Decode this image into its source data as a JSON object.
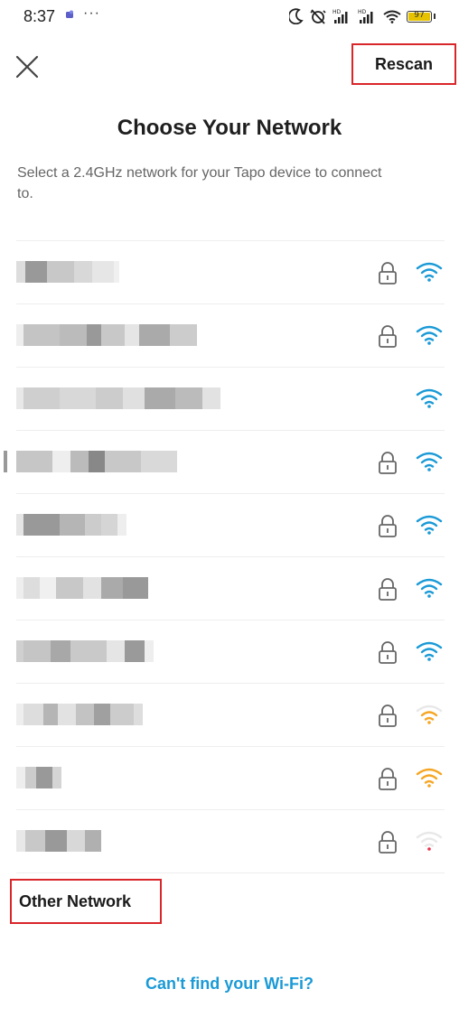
{
  "status_bar": {
    "time": "8:37",
    "more": "···",
    "battery": "97"
  },
  "header": {
    "rescan_label": "Rescan"
  },
  "title": "Choose Your Network",
  "subtitle": "Select a 2.4GHz network for your Tapo device to connect to.",
  "networks": [
    {
      "name_hidden": true,
      "secured": true,
      "signal": "strong",
      "signal_color": "#1a9ad6"
    },
    {
      "name_hidden": true,
      "secured": true,
      "signal": "strong",
      "signal_color": "#1a9ad6"
    },
    {
      "name_hidden": true,
      "secured": false,
      "signal": "strong",
      "signal_color": "#1a9ad6"
    },
    {
      "name_hidden": true,
      "secured": true,
      "signal": "strong",
      "signal_color": "#1a9ad6"
    },
    {
      "name_hidden": true,
      "secured": true,
      "signal": "strong",
      "signal_color": "#1a9ad6"
    },
    {
      "name_hidden": true,
      "secured": true,
      "signal": "strong",
      "signal_color": "#1a9ad6"
    },
    {
      "name_hidden": true,
      "secured": true,
      "signal": "strong",
      "signal_color": "#1a9ad6"
    },
    {
      "name_hidden": true,
      "secured": true,
      "signal": "medium",
      "signal_color": "#f5a623"
    },
    {
      "name_hidden": true,
      "secured": true,
      "signal": "medium",
      "signal_color": "#f5a623"
    },
    {
      "name_hidden": true,
      "secured": true,
      "signal": "weak",
      "signal_color": "#e8344e"
    }
  ],
  "other_network_label": "Other Network",
  "cant_find_label": "Can't find your Wi-Fi?"
}
